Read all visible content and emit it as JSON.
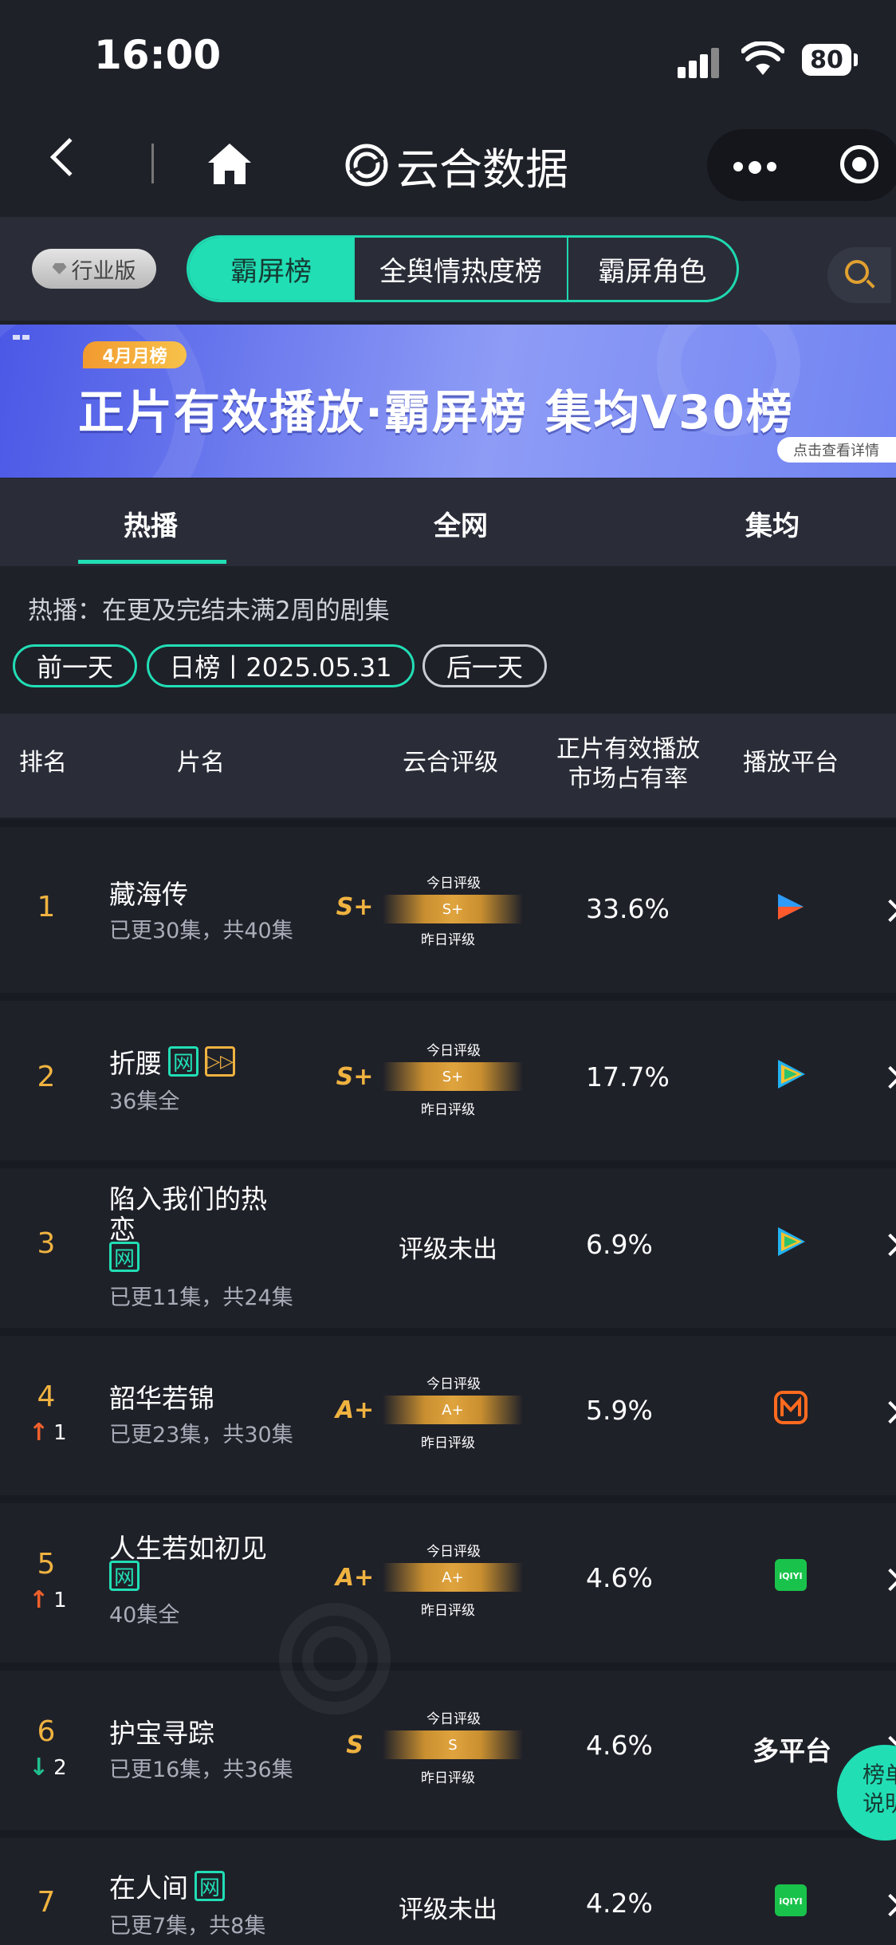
{
  "status_bar": {
    "time": "16:00",
    "battery": "80"
  },
  "nav": {
    "title": "云合数据"
  },
  "top_tabs": {
    "industry_badge": "行业版",
    "tabs": [
      {
        "label": "霸屏榜",
        "active": true
      },
      {
        "label": "全舆情热度榜",
        "active": false
      },
      {
        "label": "霸屏角色",
        "active": false
      }
    ]
  },
  "banner": {
    "badge": "4月月榜",
    "title": "正片有效播放·霸屏榜 集均V30榜",
    "link": "点击查看详情"
  },
  "sub_tabs": [
    {
      "label": "热播",
      "active": true
    },
    {
      "label": "全网",
      "active": false
    },
    {
      "label": "集均",
      "active": false
    }
  ],
  "description": "热播：在更及完结未满2周的剧集",
  "date_controls": {
    "prev": "前一天",
    "current": "日榜丨2025.05.31",
    "next": "后一天"
  },
  "table": {
    "headers": {
      "rank": "排名",
      "title": "片名",
      "grade": "云合评级",
      "share_line1": "正片有效播放",
      "share_line2": "市场占有率",
      "platform": "播放平台"
    },
    "grade_top_label": "今日评级",
    "grade_bottom_label": "昨日评级",
    "rows": [
      {
        "rank": "1",
        "change": "",
        "title": "藏海传",
        "tag": "",
        "progress": "已更30集，共40集",
        "grade": "S+",
        "grade_today": "S+",
        "share": "33.6%",
        "platform": "youku-icon"
      },
      {
        "rank": "2",
        "change": "",
        "title": "折腰",
        "tag": "网",
        "progress": "36集全",
        "grade": "S+",
        "grade_today": "S+",
        "share": "17.7%",
        "platform": "tencent-video-icon"
      },
      {
        "rank": "3",
        "change": "",
        "title": "陷入我们的热恋",
        "tag": "网",
        "progress": "已更11集，共24集",
        "grade": "评级未出",
        "grade_today": "",
        "share": "6.9%",
        "platform": "tencent-video-icon"
      },
      {
        "rank": "4",
        "change": "1",
        "change_dir": "up",
        "title": "韶华若锦",
        "tag": "",
        "progress": "已更23集，共30集",
        "grade": "A+",
        "grade_today": "A+",
        "share": "5.9%",
        "platform": "mango-tv-icon"
      },
      {
        "rank": "5",
        "change": "1",
        "change_dir": "up",
        "title": "人生若如初见",
        "tag": "网",
        "progress": "40集全",
        "grade": "A+",
        "grade_today": "A+",
        "share": "4.6%",
        "platform": "iqiyi-icon"
      },
      {
        "rank": "6",
        "change": "2",
        "change_dir": "down",
        "title": "护宝寻踪",
        "tag": "",
        "progress": "已更16集，共36集",
        "grade": "S",
        "grade_today": "S",
        "share": "4.6%",
        "platform": "多平台"
      },
      {
        "rank": "7",
        "change": "",
        "title": "在人间",
        "tag": "网",
        "progress": "已更7集，共8集",
        "grade": "评级未出",
        "grade_today": "",
        "share": "4.2%",
        "platform": "iqiyi-icon"
      }
    ],
    "row3_title_line1": "陷入我们的热",
    "row3_title_line2": "恋"
  },
  "float_button": {
    "line1": "榜单",
    "line2": "说明"
  },
  "colors": {
    "accent": "#21deb5",
    "gold": "#f0b340",
    "background": "#1f2129",
    "panel": "#2a2d38"
  }
}
